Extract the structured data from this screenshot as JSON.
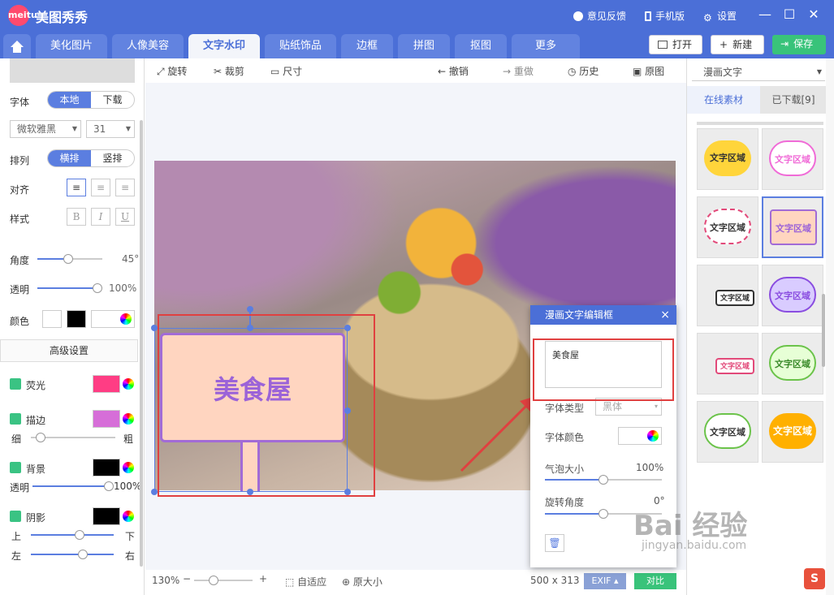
{
  "app": {
    "title": "美图秀秀",
    "logo_text": "meitu"
  },
  "titlebar": {
    "feedback": "意见反馈",
    "mobile": "手机版",
    "settings": "设置"
  },
  "tabs": [
    "美化图片",
    "人像美容",
    "文字水印",
    "贴纸饰品",
    "边框",
    "拼图",
    "抠图",
    "更多"
  ],
  "active_tab": "文字水印",
  "header_buttons": {
    "open": "打开",
    "new": "新建",
    "save": "保存"
  },
  "left": {
    "font_label": "字体",
    "font_tabs": [
      "本地",
      "下载"
    ],
    "font_name": "微软雅黑",
    "font_size": "31",
    "arrange_label": "排列",
    "arrange_tabs": [
      "横排",
      "竖排"
    ],
    "align_label": "对齐",
    "style_label": "样式",
    "style_b": "B",
    "style_i": "I",
    "style_u": "U",
    "angle_label": "角度",
    "angle_value": "45°",
    "angle_level": 0.47,
    "opacity_label": "透明",
    "opacity_value": "100%",
    "opacity_level": 1.0,
    "color_label": "颜色",
    "advanced": "高级设置",
    "glow_label": "荧光",
    "glow_color": "#ff3d84",
    "stroke_label": "描边",
    "stroke_color": "#d66ed8",
    "thin": "细",
    "thick": "粗",
    "bg_label": "背景",
    "bg_color": "#000000",
    "bg_opacity_label": "透明",
    "bg_opacity_value": "100%",
    "shadow_label": "阴影",
    "shadow_color": "#000000",
    "up": "上",
    "down": "下",
    "left": "左",
    "right": "右"
  },
  "toolbar": {
    "rotate": "旋转",
    "crop": "裁剪",
    "size": "尺寸",
    "undo": "撤销",
    "redo": "重做",
    "history": "历史",
    "original": "原图"
  },
  "canvas": {
    "sign_text": "美食屋"
  },
  "status": {
    "zoom": "130%",
    "fit": "自适应",
    "actual": "原大小",
    "dimensions": "500 x 313",
    "exif": "EXIF",
    "compare": "对比"
  },
  "right": {
    "category": "漫画文字",
    "tabs": [
      "在线素材",
      "已下载[9]"
    ],
    "thumbs": [
      "文字区域",
      "文字区域",
      "文字区域",
      "文字区域",
      "文字区域",
      "文字区域",
      "文字区域",
      "文字区域",
      "文字区域",
      "文字区域"
    ]
  },
  "dialog": {
    "title": "漫画文字编辑框",
    "close": "×",
    "text": "美食屋",
    "font_type_label": "字体类型",
    "font_type_value": "黑体",
    "font_color_label": "字体颜色",
    "bubble_label": "气泡大小",
    "bubble_value": "100%",
    "bubble_level": 0.5,
    "rotate_label": "旋转角度",
    "rotate_value": "0°",
    "rotate_level": 0.5
  },
  "watermark": {
    "main": "Bai 经验",
    "sub": "jingyan.baidu.com"
  },
  "taskbar_icon": "S"
}
